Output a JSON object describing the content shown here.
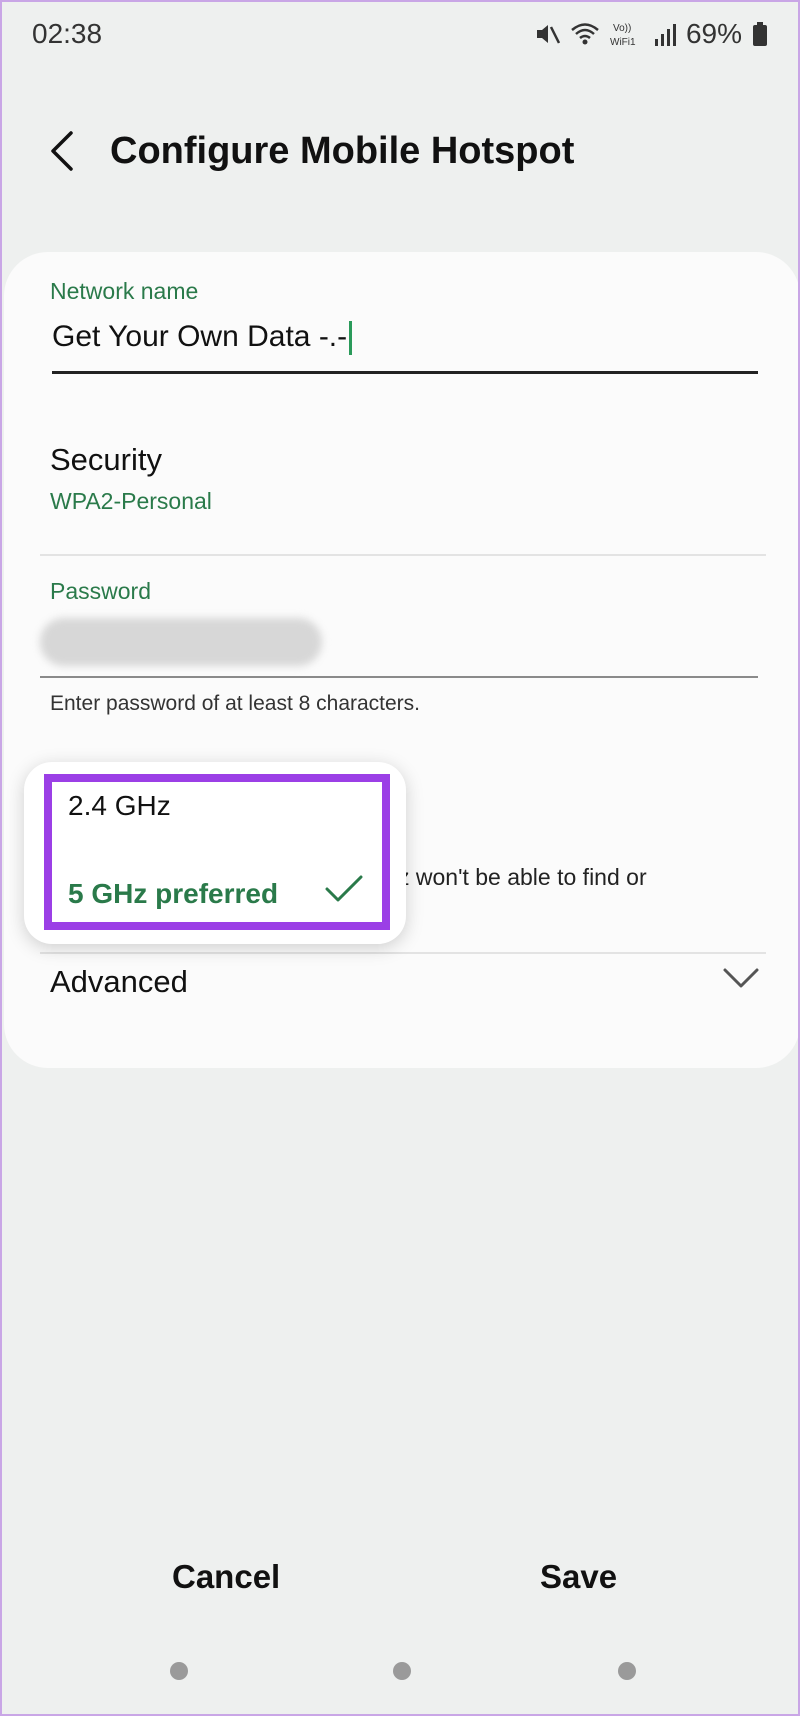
{
  "status_bar": {
    "time": "02:38",
    "battery_percent": "69%",
    "wifi_label": "Vo)) WiFi1",
    "icons": [
      "mute-icon",
      "wifi-icon",
      "vowifi-icon",
      "signal-icon",
      "battery-icon"
    ]
  },
  "header": {
    "title": "Configure Mobile Hotspot",
    "back_icon": "chevron-left-icon"
  },
  "network": {
    "label": "Network name",
    "value": "Get Your Own Data -.-"
  },
  "security": {
    "title": "Security",
    "value": "WPA2-Personal"
  },
  "password": {
    "label": "Password",
    "hint": "Enter password of at least 8 characters."
  },
  "band": {
    "note_fragment": "z won't be able to find or",
    "options": [
      {
        "label": "2.4 GHz",
        "selected": false
      },
      {
        "label": "5 GHz preferred",
        "selected": true
      }
    ]
  },
  "advanced": {
    "label": "Advanced",
    "icon": "chevron-down-icon"
  },
  "actions": {
    "cancel": "Cancel",
    "save": "Save"
  },
  "colors": {
    "accent_green": "#2a7a4a",
    "highlight_purple": "#9b3fe6",
    "background": "#eef0ef",
    "card": "#fbfbfb"
  }
}
